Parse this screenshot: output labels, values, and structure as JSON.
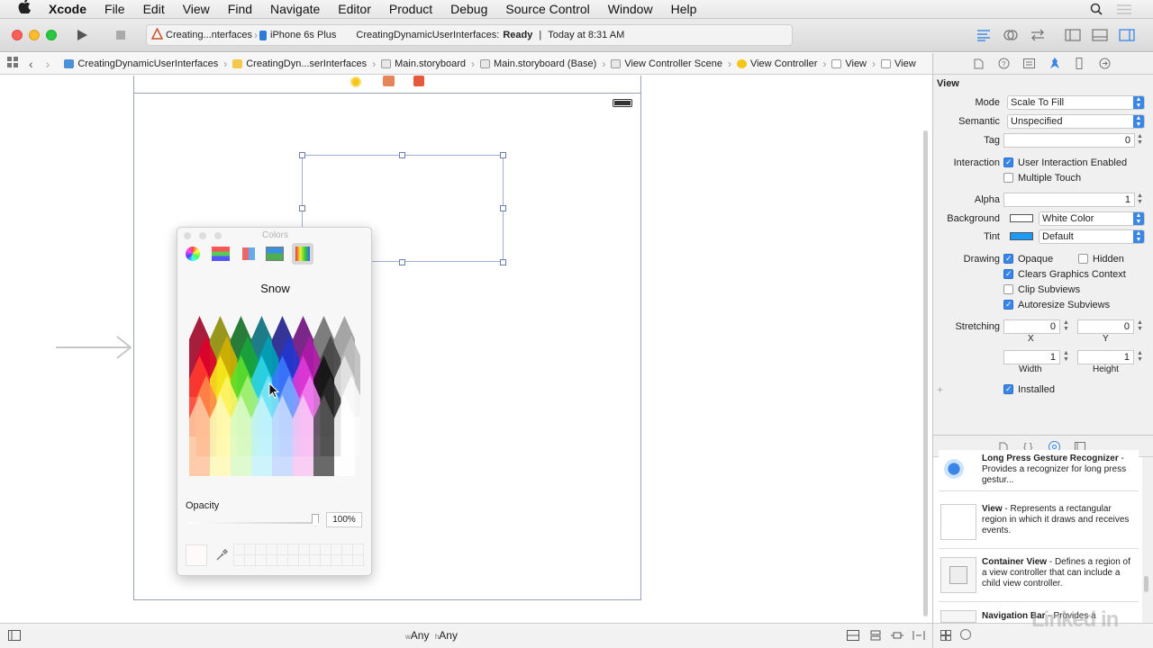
{
  "menubar": {
    "apple": "",
    "app": "Xcode",
    "items": [
      "File",
      "Edit",
      "View",
      "Find",
      "Navigate",
      "Editor",
      "Product",
      "Debug",
      "Source Control",
      "Window",
      "Help"
    ]
  },
  "toolbar": {
    "scheme": "Creating...nterfaces",
    "device": "iPhone 6s Plus",
    "project": "CreatingDynamicUserInterfaces:",
    "state": "Ready",
    "divider": "|",
    "time": "Today at 8:31 AM"
  },
  "jumpbar": {
    "crumbs": [
      "CreatingDynamicUserInterfaces",
      "CreatingDyn...serInterfaces",
      "Main.storyboard",
      "Main.storyboard (Base)",
      "View Controller Scene",
      "View Controller",
      "View",
      "View"
    ]
  },
  "colors_panel": {
    "title": "Colors",
    "color_name": "Snow",
    "opacity_label": "Opacity",
    "opacity_value": "100%"
  },
  "inspector": {
    "section": "View",
    "mode_label": "Mode",
    "mode_value": "Scale To Fill",
    "semantic_label": "Semantic",
    "semantic_value": "Unspecified",
    "tag_label": "Tag",
    "tag_value": "0",
    "interaction_label": "Interaction",
    "user_interaction": "User Interaction Enabled",
    "multiple_touch": "Multiple Touch",
    "alpha_label": "Alpha",
    "alpha_value": "1",
    "background_label": "Background",
    "background_value": "White Color",
    "tint_label": "Tint",
    "tint_value": "Default",
    "drawing_label": "Drawing",
    "opaque": "Opaque",
    "hidden": "Hidden",
    "clears": "Clears Graphics Context",
    "clip": "Clip Subviews",
    "autoresize": "Autoresize Subviews",
    "stretching_label": "Stretching",
    "stretch_x": "0",
    "stretch_y": "0",
    "x_label": "X",
    "y_label": "Y",
    "width_value": "1",
    "height_value": "1",
    "width_label": "Width",
    "height_label": "Height",
    "installed": "Installed",
    "plus": "+"
  },
  "library": {
    "items": [
      {
        "title": "Long Press Gesture Recognizer",
        "desc": " - Provides a recognizer for long press gestur..."
      },
      {
        "title": "View",
        "desc": " - Represents a rectangular region in which it draws and receives events."
      },
      {
        "title": "Container View",
        "desc": " - Defines a region of a view controller that can include a child view controller."
      },
      {
        "title": "Navigation Bar",
        "desc": " - Provides a"
      }
    ]
  },
  "bottombar": {
    "w_prefix": "w",
    "w_value": "Any",
    "h_prefix": "h",
    "h_value": "Any"
  },
  "watermark": "Linked in",
  "colors": {
    "accent": "#3a86e6",
    "tint_swatch": "#1b9af7"
  }
}
